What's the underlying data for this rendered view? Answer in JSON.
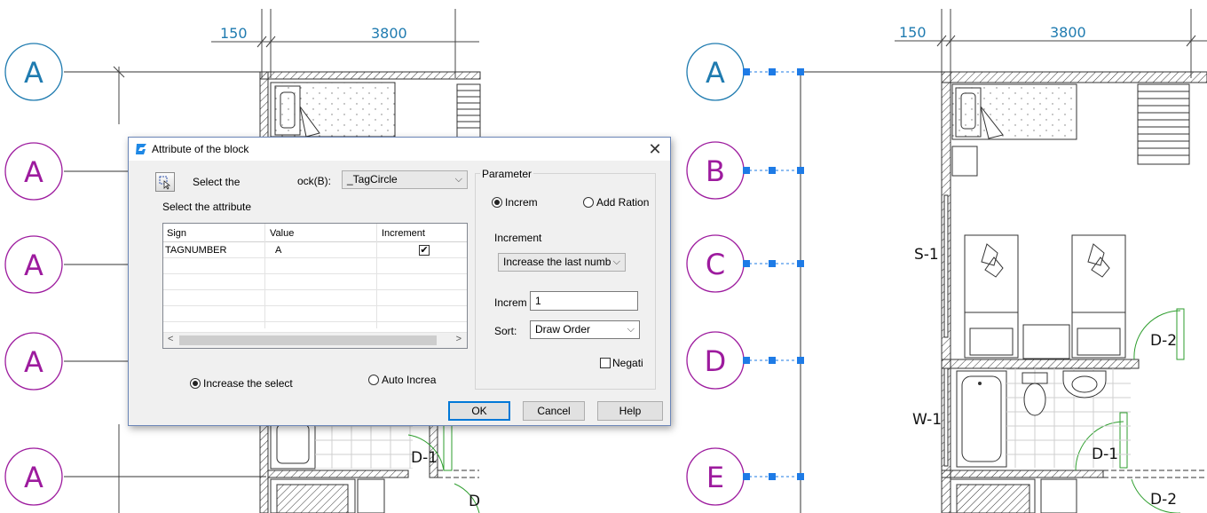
{
  "cad": {
    "left_dims": [
      "150",
      "3800"
    ],
    "right_dims": [
      "150",
      "3800"
    ],
    "left_tags": [
      "A",
      "A",
      "A",
      "A",
      "A"
    ],
    "right_tags": [
      "A",
      "B",
      "C",
      "D",
      "E"
    ],
    "room_labels": {
      "left_door": "D-1",
      "left_door2": "D",
      "right_window1": "S-1",
      "right_window2": "W-1",
      "right_door1": "D-2",
      "right_door2": "D-1",
      "right_door3": "D-2"
    },
    "colors": {
      "blue_tag": "#1f7bb0",
      "magenta_tag": "#9d1b9e",
      "grip": "#1e7be6"
    }
  },
  "dialog": {
    "title": "Attribute of the block",
    "close_glyph": "✕",
    "select_label": "Select the",
    "block_label": "ock(B):",
    "block_value": "_TagCircle",
    "select_attribute_label": "Select the attribute",
    "table": {
      "headers": [
        "Sign",
        "Value",
        "Increment"
      ],
      "rows": [
        {
          "sign": "TAGNUMBER",
          "value": "A",
          "increment": "✔"
        }
      ]
    },
    "radio_increase_selected": "Increase the select",
    "radio_auto_increase": "Auto Increa",
    "parameter": {
      "legend": "Parameter",
      "radio_increment": "Increm",
      "radio_add_ration": "Add Ration",
      "increment_label": "Increment",
      "increment_mode": "Increase the last numb",
      "increment_value_label": "Increm",
      "increment_value": "1",
      "sort_label": "Sort:",
      "sort_value": "Draw Order",
      "negative_label": "Negati"
    },
    "buttons": {
      "ok": "OK",
      "cancel": "Cancel",
      "help": "Help"
    }
  }
}
